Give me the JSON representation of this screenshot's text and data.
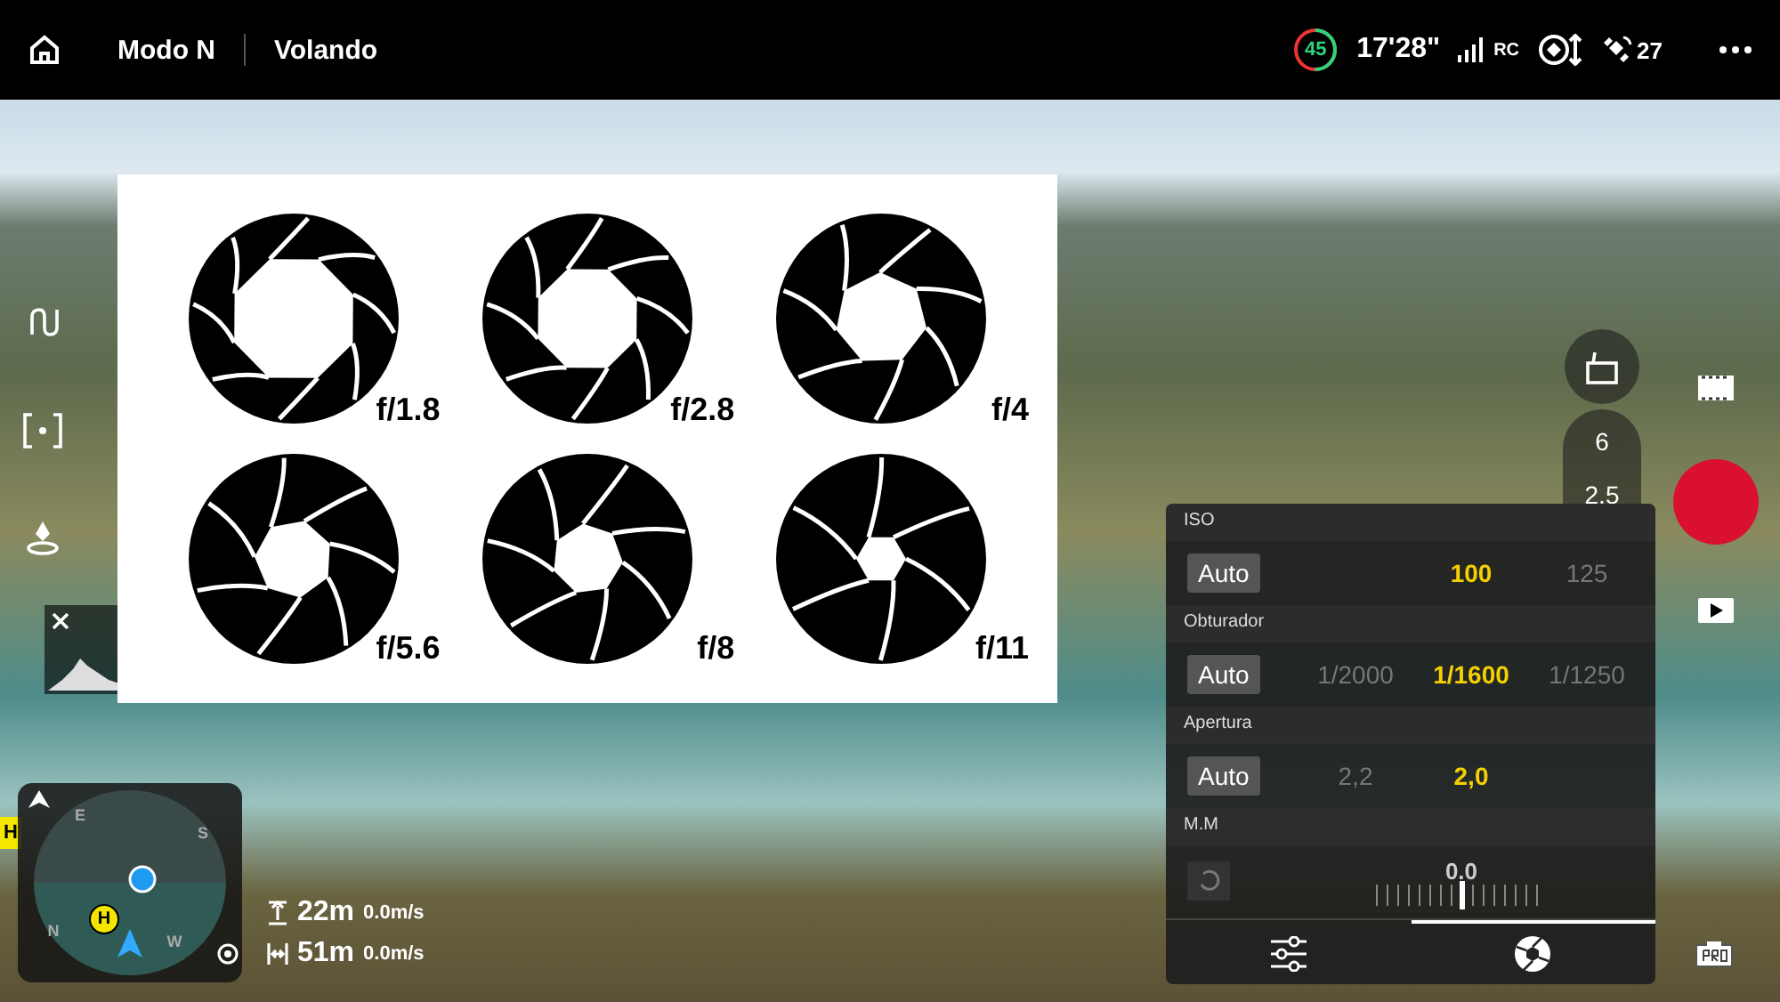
{
  "top_bar": {
    "mode": "Modo N",
    "status": "Volando",
    "battery": {
      "reading": "45",
      "level": 0.5
    },
    "flight_time": "17'28\"",
    "rc_label": "RC",
    "satellites": "27"
  },
  "aperture_chart": {
    "items": [
      {
        "label": "f/1.8"
      },
      {
        "label": "f/2.8"
      },
      {
        "label": "f/4"
      },
      {
        "label": "f/5.6"
      },
      {
        "label": "f/8"
      },
      {
        "label": "f/11"
      }
    ]
  },
  "right_controls": {
    "zoom_values": [
      "6",
      "2.5"
    ]
  },
  "camera_panel": {
    "sections": [
      {
        "title": "ISO",
        "auto": "Auto",
        "options": [
          {
            "label": "100",
            "selected": true
          },
          {
            "label": "125",
            "selected": false
          }
        ]
      },
      {
        "title": "Obturador",
        "auto": "Auto",
        "options": [
          {
            "label": "1/2000",
            "selected": false
          },
          {
            "label": "1/1600",
            "selected": true
          },
          {
            "label": "1/1250",
            "selected": false
          }
        ]
      },
      {
        "title": "Apertura",
        "auto": "Auto",
        "options": [
          {
            "label": "2,2",
            "selected": false
          },
          {
            "label": "2,0",
            "selected": true
          }
        ]
      }
    ],
    "exposure": {
      "title": "M.M",
      "reading": "0.0",
      "level": 0.5
    },
    "tabs": [
      {
        "kind": "settings",
        "selected": false
      },
      {
        "kind": "aperture",
        "selected": true
      }
    ]
  },
  "map": {
    "compass": [
      "E",
      "S",
      "W",
      "N"
    ],
    "home": "H",
    "marker": "H"
  },
  "telemetry": [
    {
      "kind": "height",
      "distance": "22m",
      "speed": "0.0m/s"
    },
    {
      "kind": "distance",
      "distance": "51m",
      "speed": "0.0m/s"
    }
  ]
}
